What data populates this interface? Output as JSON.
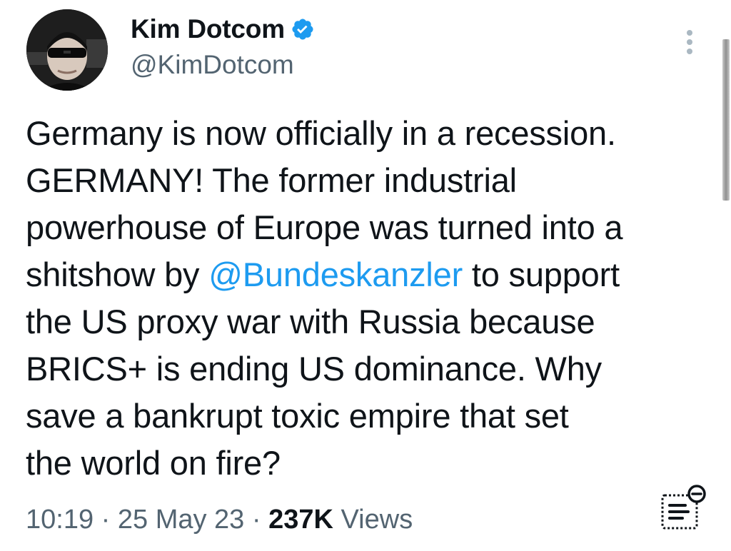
{
  "author": {
    "display_name": "Kim Dotcom",
    "handle": "@KimDotcom",
    "verified": true,
    "verified_color": "#1d9bf0"
  },
  "tweet": {
    "lines": [
      [
        "Germany is now officially in a recession."
      ],
      [
        "GERMANY! The former industrial"
      ],
      [
        "powerhouse of Europe was turned into a"
      ],
      [
        "shitshow by ",
        "@Bundeskanzler",
        " to support"
      ],
      [
        "the US proxy war with Russia because"
      ],
      [
        "BRICS+ is ending US dominance. Why"
      ],
      [
        "save a bankrupt toxic empire that set"
      ],
      [
        "the world on fire?"
      ]
    ],
    "mention": "@Bundeskanzler",
    "mention_color": "#1d9bf0"
  },
  "meta": {
    "time": "10:19",
    "separator": " · ",
    "date": "25 May 23",
    "views_count": "237K",
    "views_label": " Views"
  },
  "icons": {
    "more": "more-vertical-icon",
    "verified": "verified-badge-icon",
    "notes": "notes-icon"
  },
  "colors": {
    "text": "#0f1419",
    "secondary": "#536471",
    "accent": "#1d9bf0"
  }
}
